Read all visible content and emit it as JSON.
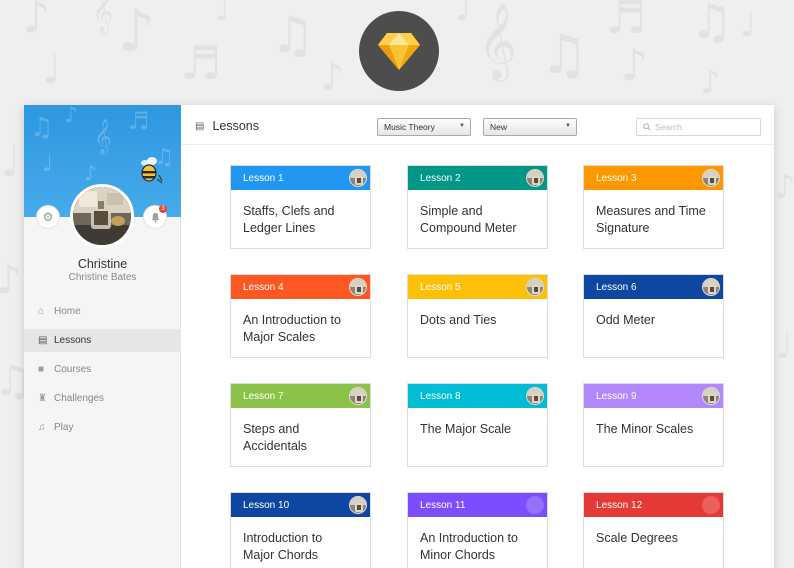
{
  "colors": {
    "sidebar_banner": "#3aa1e6",
    "logo_bg": "#4d4d4d",
    "lesson_1": "#2196f3",
    "lesson_2": "#009688",
    "lesson_3": "#ff9800",
    "lesson_4": "#ff5722",
    "lesson_5": "#ffc107",
    "lesson_6": "#0d47a1",
    "lesson_7": "#8bc34a",
    "lesson_8": "#00bcd4",
    "lesson_9": "#b388ff",
    "lesson_10": "#0d47a1",
    "lesson_11": "#7c4dff",
    "lesson_12": "#e53935"
  },
  "app_logo": {
    "icon": "diamond-icon"
  },
  "user": {
    "name": "Christine",
    "full_name": "Christine Bates",
    "notifications": "3",
    "settings_icon": "gear-icon",
    "bell_icon": "bell-icon"
  },
  "sidebar": {
    "items": [
      {
        "label": "Home",
        "icon": "home-icon",
        "active": false
      },
      {
        "label": "Lessons",
        "icon": "document-icon",
        "active": true
      },
      {
        "label": "Courses",
        "icon": "briefcase-icon",
        "active": false
      },
      {
        "label": "Challenges",
        "icon": "trophy-icon",
        "active": false
      },
      {
        "label": "Play",
        "icon": "music-note-icon",
        "active": false
      }
    ]
  },
  "header": {
    "title": "Lessons",
    "filter_topic": {
      "value": "Music Theory"
    },
    "filter_sort": {
      "value": "New"
    },
    "search": {
      "placeholder": "Search",
      "value": ""
    }
  },
  "lessons": [
    {
      "label": "Lesson 1",
      "title_line1": "Staffs, Clefs and",
      "title_line2": "Ledger Lines",
      "color": "#2196f3",
      "thumb": true
    },
    {
      "label": "Lesson 2",
      "title_line1": "Simple and",
      "title_line2": "Compound Meter",
      "color": "#009688",
      "thumb": true
    },
    {
      "label": "Lesson 3",
      "title_line1": "Measures and Time",
      "title_line2": "Signature",
      "color": "#ff9800",
      "thumb": true
    },
    {
      "label": "Lesson 4",
      "title_line1": "An Introduction to",
      "title_line2": "Major Scales",
      "color": "#ff5722",
      "thumb": true
    },
    {
      "label": "Lesson 5",
      "title_line1": "Dots and Ties",
      "title_line2": "",
      "color": "#ffc107",
      "thumb": true
    },
    {
      "label": "Lesson 6",
      "title_line1": "Odd Meter",
      "title_line2": "",
      "color": "#0d47a1",
      "thumb": true
    },
    {
      "label": "Lesson 7",
      "title_line1": "Steps and",
      "title_line2": "Accidentals",
      "color": "#8bc34a",
      "thumb": true
    },
    {
      "label": "Lesson 8",
      "title_line1": "The Major Scale",
      "title_line2": "",
      "color": "#00bcd4",
      "thumb": true
    },
    {
      "label": "Lesson 9",
      "title_line1": "The Minor Scales",
      "title_line2": "",
      "color": "#b388ff",
      "thumb": true
    },
    {
      "label": "Lesson 10",
      "title_line1": "Introduction to",
      "title_line2": "Major Chords",
      "color": "#0d47a1",
      "thumb": true
    },
    {
      "label": "Lesson 11",
      "title_line1": "An Introduction to",
      "title_line2": "Minor Chords",
      "color": "#7c4dff",
      "thumb": false
    },
    {
      "label": "Lesson 12",
      "title_line1": "Scale Degrees",
      "title_line2": "",
      "color": "#e53935",
      "thumb": false
    }
  ]
}
